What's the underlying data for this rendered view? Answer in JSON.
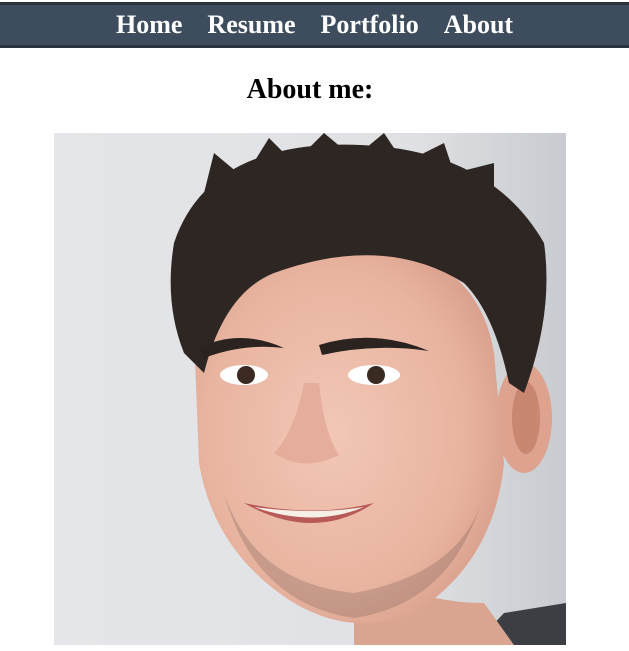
{
  "nav": {
    "items": [
      {
        "label": "Home"
      },
      {
        "label": "Resume"
      },
      {
        "label": "Portfolio"
      },
      {
        "label": "About"
      }
    ]
  },
  "main": {
    "heading": "About me:",
    "photo_icon": "portrait-photo"
  },
  "colors": {
    "navbar_bg": "#3d4d5e",
    "navbar_border": "#2a323c",
    "nav_text": "#ffffff",
    "page_bg": "#ffffff"
  }
}
